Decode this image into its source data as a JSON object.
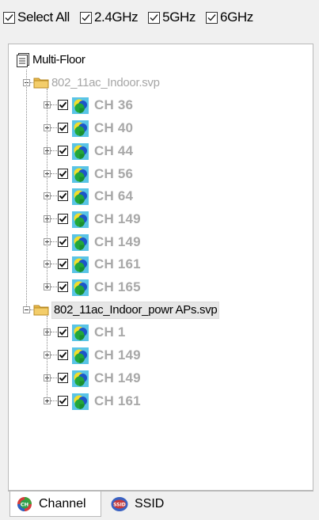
{
  "filters": {
    "select_all": "Select All",
    "band_24": "2.4GHz",
    "band_5": "5GHz",
    "band_6": "6GHz"
  },
  "tree": {
    "root": "Multi-Floor",
    "files": [
      {
        "name": "802_11ac_Indoor.svp",
        "channels": [
          "CH 36",
          "CH 40",
          "CH 44",
          "CH 56",
          "CH 64",
          "CH 149",
          "CH 149",
          "CH 161",
          "CH 165"
        ]
      },
      {
        "name": "802_11ac_Indoor_powr APs.svp",
        "channels": [
          "CH 1",
          "CH 149",
          "CH 149",
          "CH 161"
        ]
      }
    ]
  },
  "tabs": {
    "channel": "Channel",
    "ssid": "SSID"
  },
  "icons": {
    "root": "multi-floor-document-icon",
    "file": "folder-icon",
    "channel": "ap-channel-icon",
    "tab_channel": "channel-ch-icon",
    "tab_ssid": "ssid-icon"
  }
}
